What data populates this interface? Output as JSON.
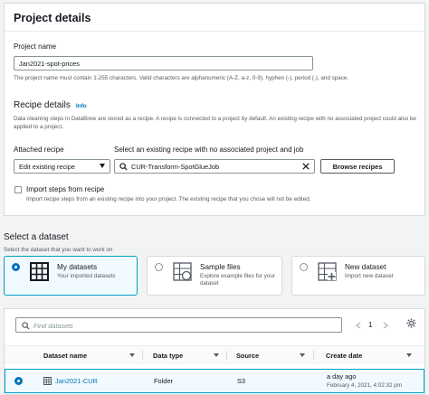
{
  "project_details": {
    "title": "Project details",
    "name_label": "Project name",
    "name_value": "Jan2021-spot-prices",
    "name_hint": "The project name must contain 1-255 characters. Valid characters are alphanumeric (A-Z, a-z, 0-9), hyphen (-), period (.), and space."
  },
  "recipe_details": {
    "title": "Recipe details",
    "info": "Info",
    "description": "Data cleaning steps in DataBrew are stored as a recipe. A recipe is connected to a project by default. An existing recipe with no associated project could also be applied to a project.",
    "attached_label": "Attached recipe",
    "attached_value": "Edit existing recipe",
    "select_label": "Select an existing recipe with no associated project and job",
    "select_value": "CUR-Transform-SpotGlueJob",
    "browse_button": "Browse recipes",
    "import_label": "Import steps from recipe",
    "import_hint": "Import recipe steps from an existing recipe into your project. The existing recipe that you chose will not be edited."
  },
  "dataset": {
    "title": "Select a dataset",
    "subtitle": "Select the dataset that you want to work on",
    "cards": [
      {
        "title": "My datasets",
        "desc": "Your imported datasets",
        "selected": true
      },
      {
        "title": "Sample files",
        "desc": "Explore example files for your dataset",
        "selected": false
      },
      {
        "title": "New dataset",
        "desc": "Import new dataset",
        "selected": false
      }
    ]
  },
  "table": {
    "search_placeholder": "Find datasets",
    "page": "1",
    "columns": [
      "Dataset name",
      "Data type",
      "Source",
      "Create date"
    ],
    "rows": [
      {
        "name": "Jan2021-CUR",
        "type": "Folder",
        "source": "S3",
        "date": "a day ago",
        "date_full": "February 4, 2021, 4:02:32 pm"
      }
    ]
  },
  "colors": {
    "accent": "#0073bb",
    "selected_bg": "#f1faff",
    "selected_border": "#00a1c9"
  }
}
